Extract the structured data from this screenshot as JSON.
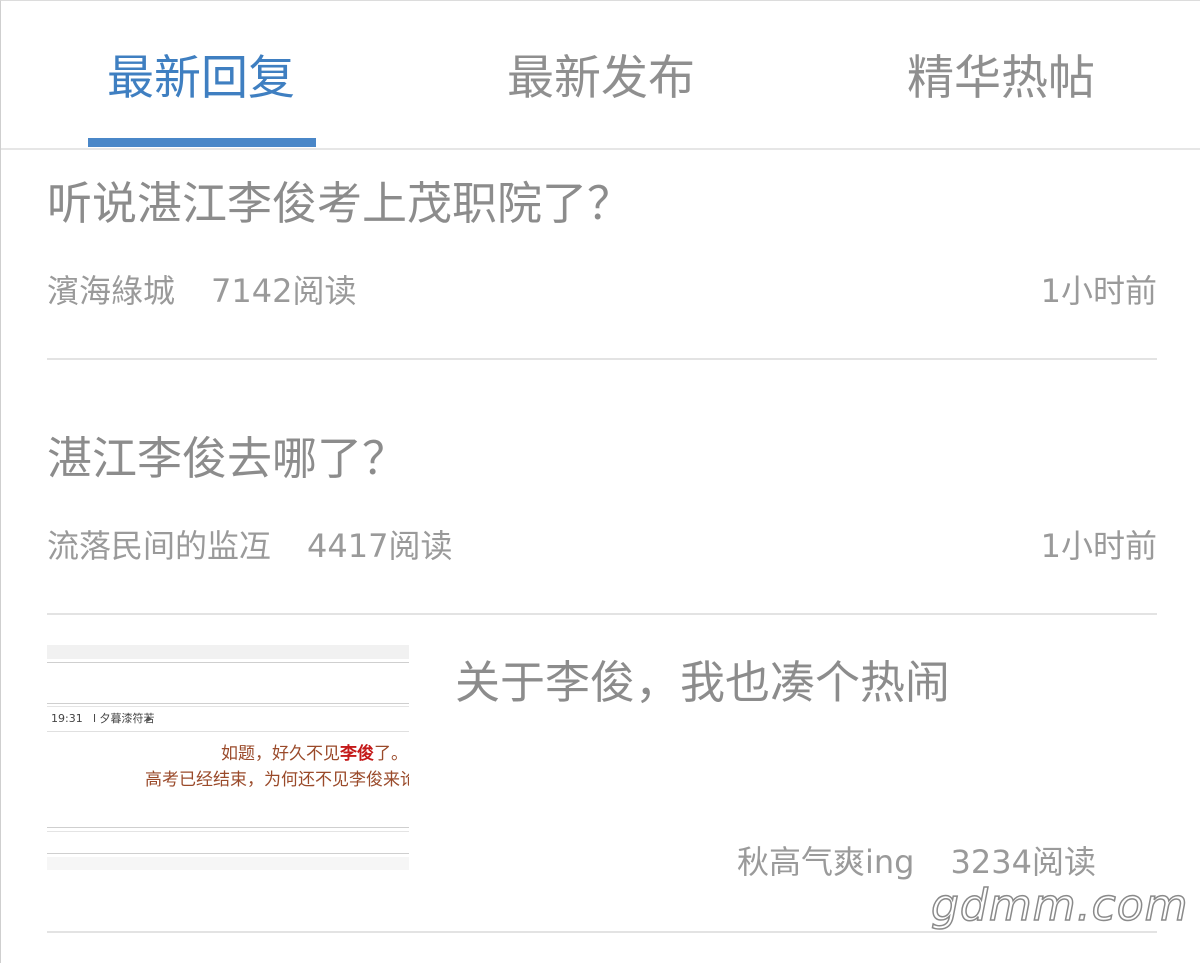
{
  "tabs": [
    {
      "label": "最新回复",
      "active": true
    },
    {
      "label": "最新发布",
      "active": false
    },
    {
      "label": "精华热帖",
      "active": false
    }
  ],
  "colors": {
    "accent": "#3f7fc1",
    "text_muted": "#8c8c8c",
    "divider": "#e3e3e3"
  },
  "posts": [
    {
      "title": "听说湛江李俊考上茂职院了？",
      "author": "濱海綠城",
      "reads": "7142阅读",
      "time": "1小时前"
    },
    {
      "title": "湛江李俊去哪了？",
      "author": "流落民间的监冱",
      "reads": "4417阅读",
      "time": "1小时前"
    },
    {
      "title": "关于李俊，我也凑个热闹",
      "author": "秋高气爽ing",
      "reads": "3234阅读",
      "thumbnail": {
        "time": "19:31",
        "user": "l 夕暮漆符若",
        "line1_prefix": "如题，好久不见",
        "line1_highlight": "李俊",
        "line1_suffix": "了。",
        "line2": "高考已经结束，为何还不见李俊来论"
      }
    }
  ],
  "watermark": "gdmm.com"
}
